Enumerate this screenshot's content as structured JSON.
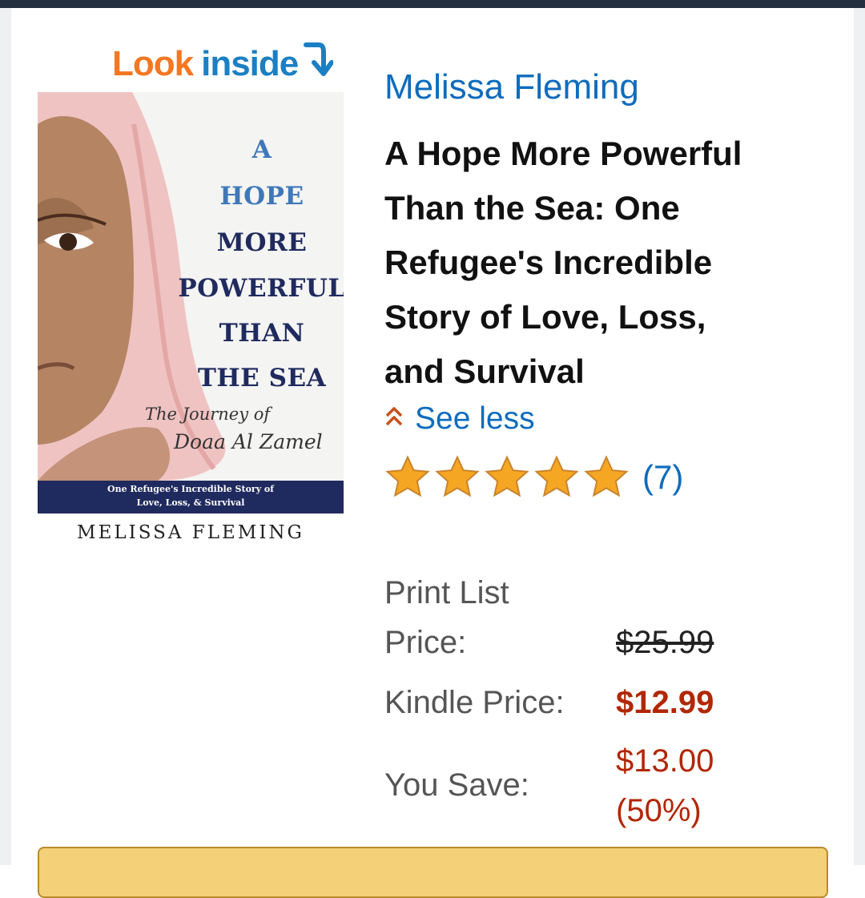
{
  "look_inside": {
    "look": "Look",
    "inside": "inside"
  },
  "cover": {
    "title_lines": [
      "A",
      "HOPE",
      "MORE",
      "POWERFUL",
      "THAN",
      "THE SEA"
    ],
    "script_line1": "The Journey of",
    "script_line2": "Doaa Al Zamel",
    "band_line1": "One Refugee's Incredible Story of",
    "band_line2": "Love, Loss, & Survival",
    "author": "MELISSA FLEMING"
  },
  "product": {
    "author": "Melissa Fleming",
    "title_lines": [
      "A Hope More Powerful",
      "Than the Sea: One",
      "Refugee's Incredible",
      "Story of Love, Loss,",
      "and Survival"
    ],
    "see_less": "See less",
    "rating_stars": 5,
    "rating_count": "(7)"
  },
  "pricing": {
    "print_list_label_line1": "Print List",
    "print_list_label_line2": "Price:",
    "print_list_price": "$25.99",
    "kindle_label": "Kindle Price:",
    "kindle_price": "$12.99",
    "save_label": "You Save:",
    "save_amount": "$13.00",
    "save_percent": "(50%)"
  },
  "colors": {
    "look": "#f47722",
    "inside": "#1b7fc4",
    "link": "#0f6cbd",
    "price_red": "#b12704",
    "star": "#f5a623",
    "button": "#f4d078"
  },
  "icons": [
    "look-inside-arrow-icon",
    "chevron-up-double-icon",
    "star-icon"
  ]
}
